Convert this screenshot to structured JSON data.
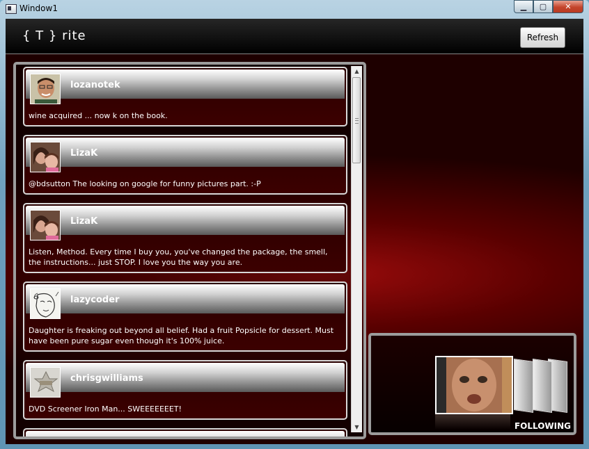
{
  "window": {
    "title": "Window1",
    "minimize": "▁",
    "maximize": "▢",
    "close": "✕"
  },
  "app": {
    "logo": "{ T } rite",
    "refresh_label": "Refresh"
  },
  "tweets": [
    {
      "user": "lozanotek",
      "text": "wine acquired ... now k on the book.",
      "avatar": "person-photo-icon"
    },
    {
      "user": "LizaK",
      "text": "@bdsutton The looking on google for funny pictures part. :-P",
      "avatar": "person-photo-icon"
    },
    {
      "user": "LizaK",
      "text": "Listen, Method. Every time I buy you, you've changed the package, the smell, the instructions... just STOP. I love you the way you are.",
      "avatar": "person-photo-icon"
    },
    {
      "user": "lazycoder",
      "text": "Daughter is freaking out beyond all belief. Had a fruit Popsicle for dessert. Must have been pure sugar even though it's 100% juice.",
      "avatar": "sketch-portrait-icon"
    },
    {
      "user": "chrisgwilliams",
      "text": "DVD Screener Iron Man...  SWEEEEEEET!",
      "avatar": "badge-icon"
    },
    {
      "user": "",
      "text": "",
      "avatar": ""
    }
  ],
  "following": {
    "label": "FOLLOWING"
  },
  "scrollbar": {
    "up": "▲",
    "down": "▼"
  },
  "colors": {
    "accent": "#8a0000",
    "panel_border": "#9c9c9c"
  }
}
